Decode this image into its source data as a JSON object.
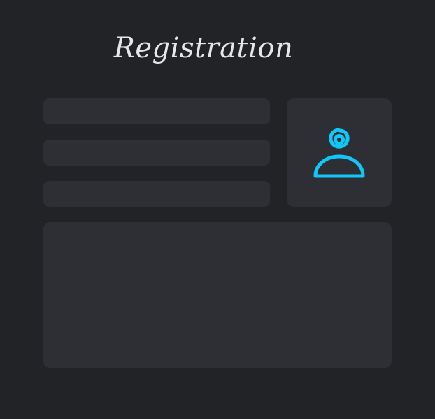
{
  "header": {
    "title": "Registration"
  },
  "form": {
    "fields": [
      {
        "value": "",
        "placeholder": ""
      },
      {
        "value": "",
        "placeholder": ""
      },
      {
        "value": "",
        "placeholder": ""
      }
    ],
    "textarea": {
      "value": "",
      "placeholder": ""
    },
    "avatar": {
      "icon": "user-avatar-icon"
    }
  },
  "colors": {
    "background": "#212327",
    "panel": "#2d2f34",
    "title_text": "#e5e7ea",
    "accent": "#12c6f7"
  }
}
